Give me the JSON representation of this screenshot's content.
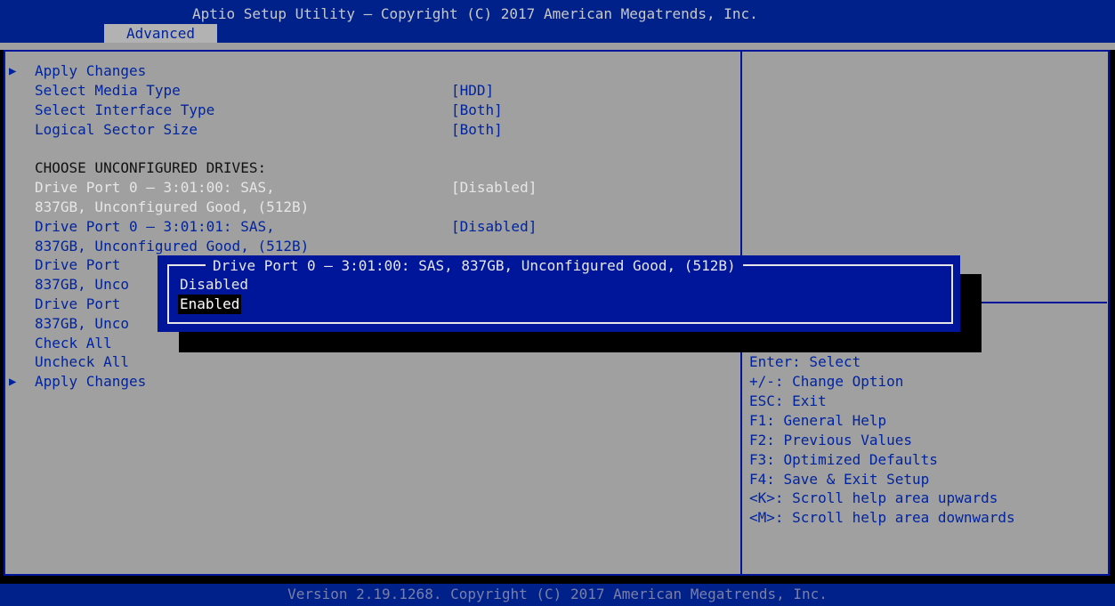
{
  "header": {
    "title": "Aptio Setup Utility – Copyright (C) 2017 American Megatrends, Inc.",
    "tab": "Advanced"
  },
  "menu": {
    "arrow_glyph": "▶",
    "apply_changes_top": "Apply Changes",
    "select_media_type": {
      "label": "Select Media Type",
      "value": "[HDD]"
    },
    "select_interface_type": {
      "label": "Select Interface Type",
      "value": "[Both]"
    },
    "logical_sector_size": {
      "label": "Logical Sector Size",
      "value": "[Both]"
    },
    "choose_header": "CHOOSE UNCONFIGURED DRIVES:",
    "drives": [
      {
        "line1": "Drive Port 0 – 3:01:00: SAS,",
        "line2": "837GB, Unconfigured Good, (512B)",
        "value": "[Disabled]"
      },
      {
        "line1": "Drive Port 0 – 3:01:01: SAS,",
        "line2": "837GB, Unconfigured Good, (512B)",
        "value": "[Disabled]"
      },
      {
        "line1": "Drive Port",
        "line2": "837GB, Unco"
      },
      {
        "line1": "Drive Port",
        "line2": "837GB, Unco"
      }
    ],
    "check_all": "Check All",
    "uncheck_all": "Uncheck All",
    "apply_changes_bottom": "Apply Changes"
  },
  "help": {
    "items": [
      "Enter: Select",
      "+/-: Change Option",
      "ESC: Exit",
      "F1: General Help",
      "F2: Previous Values",
      "F3: Optimized Defaults",
      "F4: Save & Exit Setup",
      "<K>: Scroll help area upwards",
      "<M>: Scroll help area downwards"
    ]
  },
  "popup": {
    "title": "Drive Port 0 – 3:01:00: SAS, 837GB, Unconfigured Good, (512B)",
    "options": [
      "Disabled",
      "Enabled"
    ],
    "selected": "Enabled"
  },
  "footer": {
    "text": "Version 2.19.1268. Copyright (C) 2017 American Megatrends, Inc."
  },
  "colors": {
    "bios_blue": "#00218a",
    "bios_gray": "#a0a0a0",
    "text_blue": "#0024a0",
    "text_white": "#e6e6e6"
  }
}
